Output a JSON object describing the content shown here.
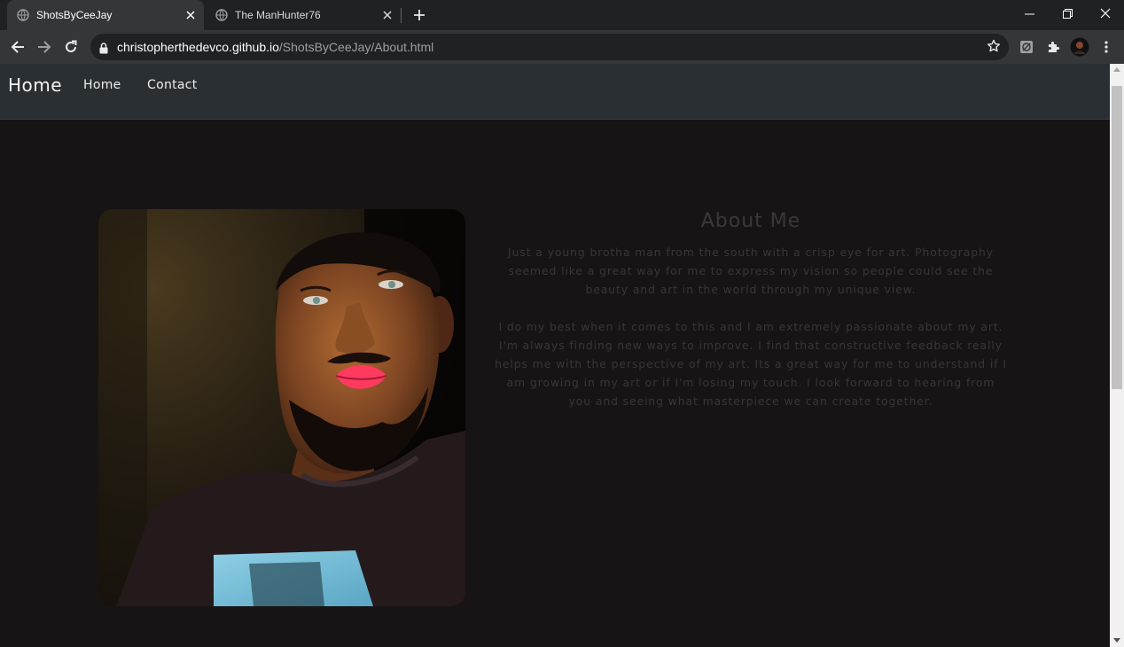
{
  "browser": {
    "tabs": [
      {
        "title": "ShotsByCeeJay",
        "active": true
      },
      {
        "title": "The ManHunter76",
        "active": false
      }
    ],
    "address": {
      "host": "christopherthedevco.github.io",
      "path": "/ShotsByCeeJay/About.html"
    },
    "icons": {
      "back": "back-arrow-icon",
      "forward": "forward-arrow-icon",
      "reload": "reload-icon",
      "lock": "lock-icon",
      "bookmark": "star-icon",
      "extension1": "extension-icon",
      "extensions": "puzzle-icon",
      "profile": "avatar",
      "menu": "kebab-menu-icon"
    }
  },
  "site": {
    "nav": {
      "brand": "Home",
      "links": [
        "Home",
        "Contact"
      ]
    },
    "about": {
      "title": "About Me",
      "paragraphs": [
        "Just a young brotha man from the south with a crisp eye for art. Photography seemed like a great way for me to express my vision so people could see the beauty and art in the world through my unique view.",
        "I do my best when it comes to this and I am extremely passionate about my art. I'm always finding new ways to improve. I find that constructive feedback really helps me with the perspective of my art. Its a great way for me to understand if I am growing in my art or if I'm losing my touch. I look forward to hearing from you and seeing what masterpiece we can create together."
      ]
    },
    "colors": {
      "page_bg": "#171415",
      "nav_bg": "#2a2f33",
      "about_text": "#3a3637"
    }
  }
}
